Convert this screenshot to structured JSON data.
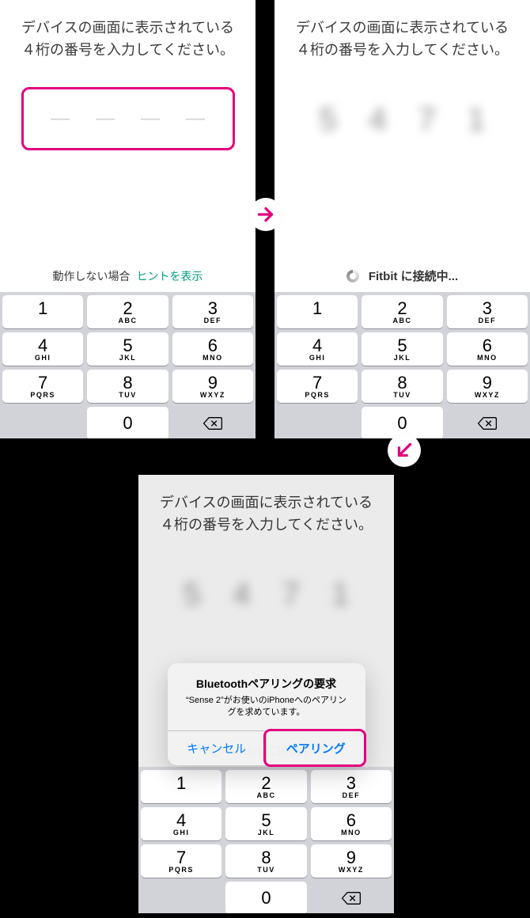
{
  "instruction": "デバイスの画面に表示されている４桁の番号を入力してください。",
  "code_digits": [
    "5",
    "4",
    "7",
    "1"
  ],
  "hint": {
    "label": "動作しない場合",
    "link": "ヒントを表示"
  },
  "connecting_text": "Fitbit に接続中...",
  "keypad": {
    "keys": [
      {
        "num": "1",
        "sub": ""
      },
      {
        "num": "2",
        "sub": "ABC"
      },
      {
        "num": "3",
        "sub": "DEF"
      },
      {
        "num": "4",
        "sub": "GHI"
      },
      {
        "num": "5",
        "sub": "JKL"
      },
      {
        "num": "6",
        "sub": "MNO"
      },
      {
        "num": "7",
        "sub": "PQRS"
      },
      {
        "num": "8",
        "sub": "TUV"
      },
      {
        "num": "9",
        "sub": "WXYZ"
      },
      {
        "num": "0",
        "sub": ""
      }
    ]
  },
  "dialog": {
    "title": "Bluetoothペアリングの要求",
    "body": "“Sense 2”がお使いのiPhoneへのペアリングを求めています。",
    "cancel": "キャンセル",
    "pair": "ペアリング"
  }
}
